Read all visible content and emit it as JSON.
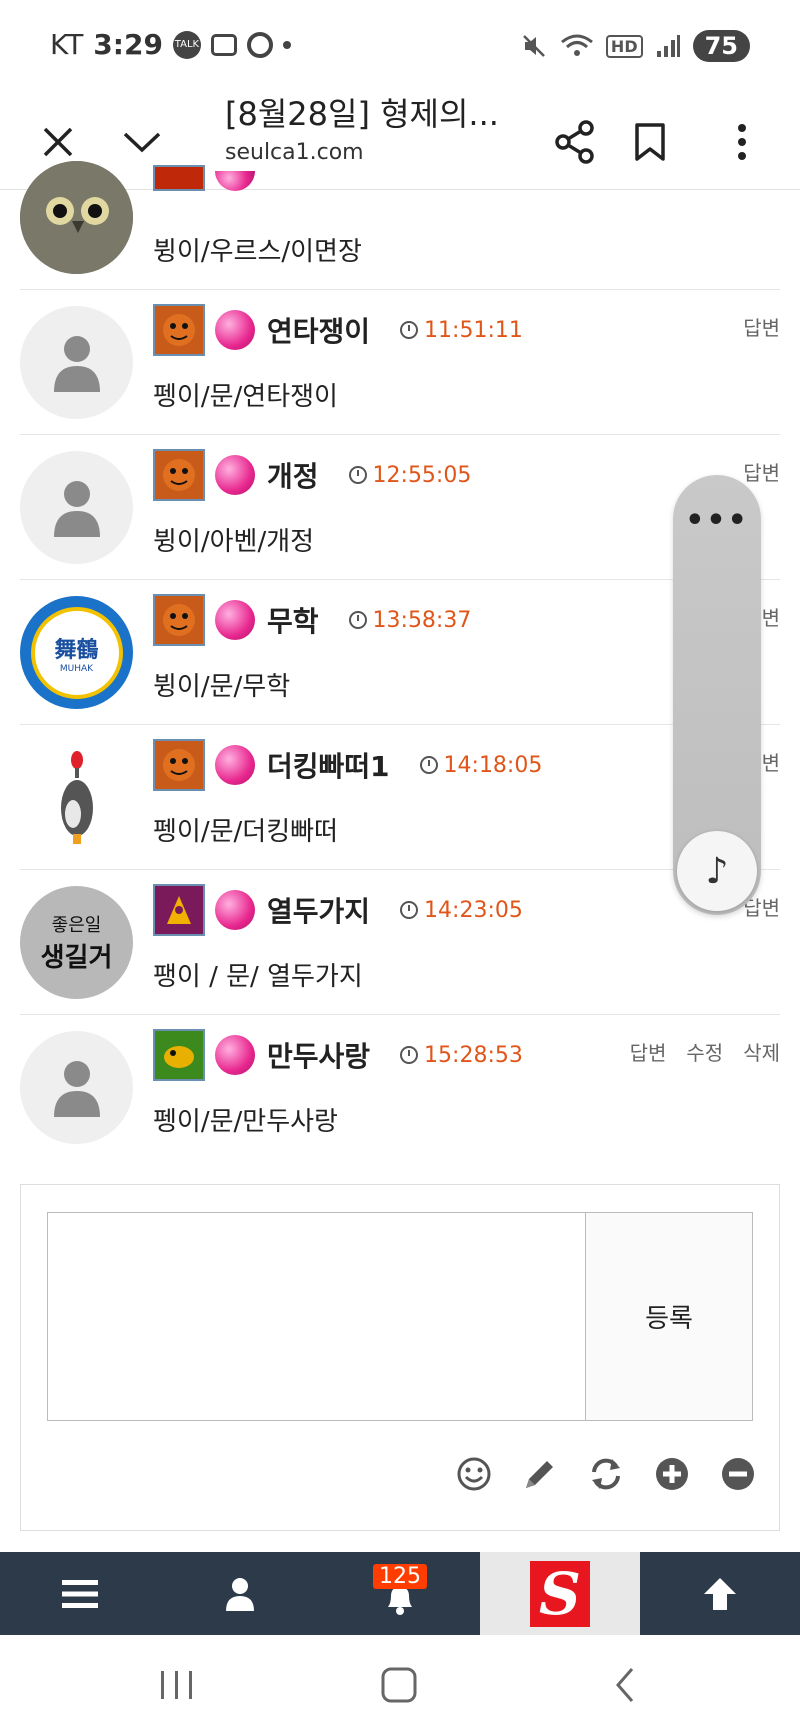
{
  "status_bar": {
    "carrier": "KT",
    "time": "3:29",
    "talk_label": "TALK",
    "hd_label": "HD",
    "battery": "75"
  },
  "browser": {
    "title": "[8월28일] 형제의...",
    "url": "seulca1.com"
  },
  "comments": [
    {
      "nick": "",
      "time": "",
      "text": "뷩이/우르스/이면장",
      "actions": []
    },
    {
      "nick": "연타쟁이",
      "time": "11:51:11",
      "text": "펭이/문/연타쟁이",
      "actions": [
        "답변"
      ]
    },
    {
      "nick": "개정",
      "time": "12:55:05",
      "text": "뷩이/아벤/개정",
      "actions": [
        "답변"
      ]
    },
    {
      "nick": "무학",
      "time": "13:58:37",
      "text": "뷩이/문/무학",
      "actions": [
        "답변"
      ]
    },
    {
      "nick": "더킹빠떠1",
      "time": "14:18:05",
      "text": "펭이/문/더킹빠떠",
      "actions": [
        "답변"
      ]
    },
    {
      "nick": "열두가지",
      "time": "14:23:05",
      "text": "팽이 / 문/ 열두가지",
      "actions": [
        "답변"
      ]
    },
    {
      "nick": "만두사랑",
      "time": "15:28:53",
      "text": "펭이/문/만두사랑",
      "actions": [
        "답변",
        "수정",
        "삭제"
      ]
    }
  ],
  "avatar_text": {
    "muhak_top": "舞鶴",
    "muhak_bottom": "MUHAK",
    "yeoldu_line1": "좋은일",
    "yeoldu_line2": "생길거"
  },
  "floater": {
    "more_label": "•••",
    "music_label": "♪"
  },
  "reply": {
    "placeholder": "",
    "submit_label": "등록"
  },
  "bottom_nav": {
    "notification_count": "125",
    "logo_letter": "S"
  }
}
